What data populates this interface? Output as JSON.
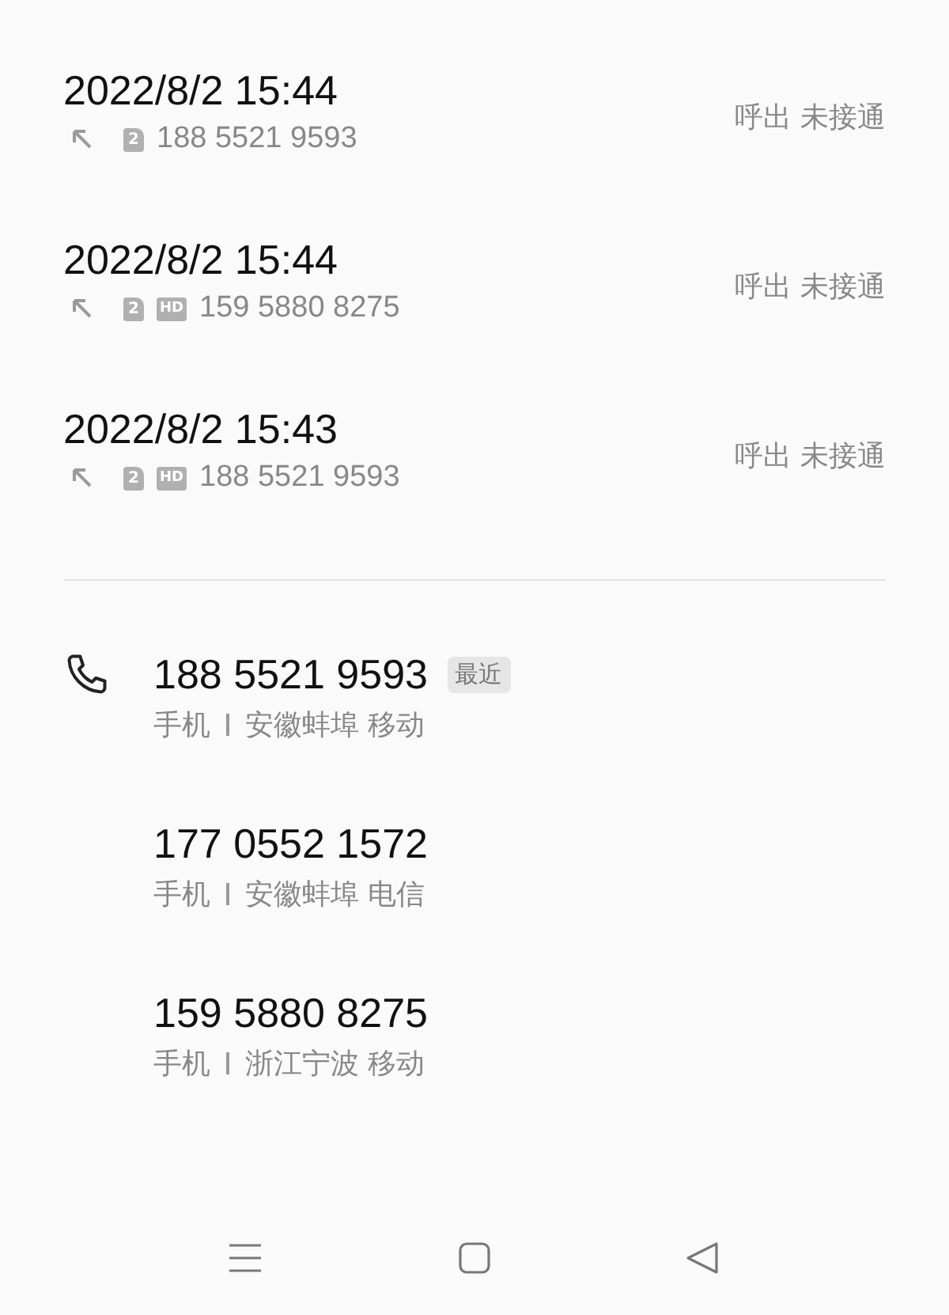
{
  "calls": [
    {
      "time": "2022/8/2 15:44",
      "kind": "outgoing",
      "sim": "2",
      "number": "188 5521 9593",
      "status": "呼出 未接通"
    },
    {
      "time": "2022/8/2 15:44",
      "kind": "outgoing",
      "sim": "2",
      "hd": "HD",
      "number": "159 5880 8275",
      "status": "呼出 未接通"
    },
    {
      "time": "2022/8/2 15:43",
      "kind": "outgoing",
      "sim": "2",
      "hd": "HD",
      "number": "188 5521 9593",
      "status": "呼出 未接通"
    }
  ],
  "numbers": [
    {
      "call_icon": true,
      "number": "188 5521 9593",
      "tag": "最近",
      "type": "手机",
      "location": "安徽蚌埠 移动"
    },
    {
      "call_icon": false,
      "number": "177 0552 1572",
      "type": "手机",
      "location": "安徽蚌埠 电信"
    },
    {
      "call_icon": false,
      "number": "159 5880 8275",
      "type": "手机",
      "location": "浙江宁波 移动"
    }
  ]
}
